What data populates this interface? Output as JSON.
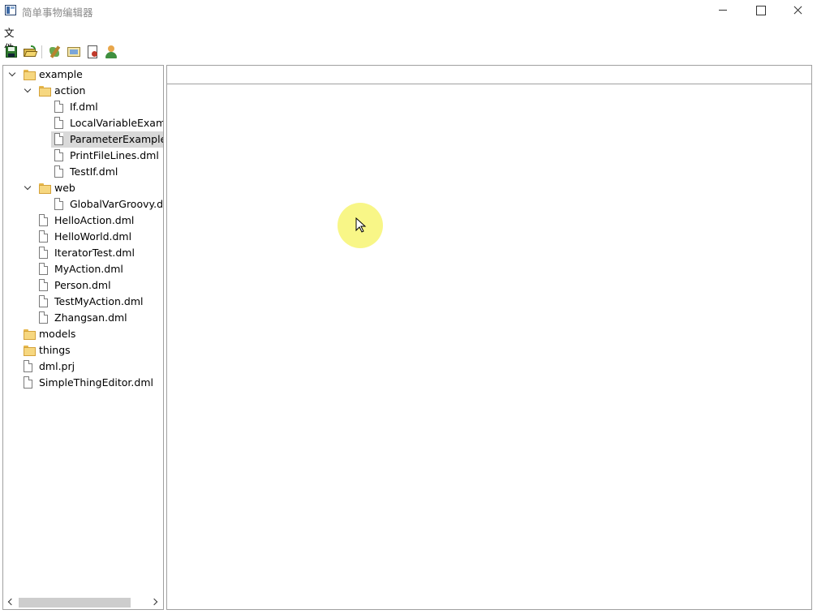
{
  "window": {
    "title": "简单事物编辑器",
    "controls": {
      "minimize": "minimize",
      "maximize": "maximize",
      "close": "close"
    }
  },
  "menu": {
    "items": [
      "文件"
    ]
  },
  "toolbar": {
    "icons": [
      "save-icon",
      "open-folder-icon",
      "thing-tool-icon",
      "image-icon",
      "document-red-icon",
      "user-icon"
    ]
  },
  "tree": {
    "nodes": [
      {
        "label": "example",
        "type": "folder",
        "depth": 0,
        "expanded": true
      },
      {
        "label": "action",
        "type": "folder",
        "depth": 1,
        "expanded": true
      },
      {
        "label": "If.dml",
        "type": "file",
        "depth": 2
      },
      {
        "label": "LocalVariableExample.dml",
        "type": "file",
        "depth": 2
      },
      {
        "label": "ParameterExample.dml",
        "type": "file",
        "depth": 2,
        "selected": true
      },
      {
        "label": "PrintFileLines.dml",
        "type": "file",
        "depth": 2
      },
      {
        "label": "TestIf.dml",
        "type": "file",
        "depth": 2
      },
      {
        "label": "web",
        "type": "folder",
        "depth": 1,
        "expanded": true
      },
      {
        "label": "GlobalVarGroovy.dml",
        "type": "file",
        "depth": 2
      },
      {
        "label": "HelloAction.dml",
        "type": "file",
        "depth": 1
      },
      {
        "label": "HelloWorld.dml",
        "type": "file",
        "depth": 1
      },
      {
        "label": "IteratorTest.dml",
        "type": "file",
        "depth": 1
      },
      {
        "label": "MyAction.dml",
        "type": "file",
        "depth": 1
      },
      {
        "label": "Person.dml",
        "type": "file",
        "depth": 1
      },
      {
        "label": "TestMyAction.dml",
        "type": "file",
        "depth": 1
      },
      {
        "label": "Zhangsan.dml",
        "type": "file",
        "depth": 1
      },
      {
        "label": "models",
        "type": "folder",
        "depth": 0,
        "expanded": false
      },
      {
        "label": "things",
        "type": "folder",
        "depth": 0,
        "expanded": false
      },
      {
        "label": "dml.prj",
        "type": "file",
        "depth": 0
      },
      {
        "label": "SimpleThingEditor.dml",
        "type": "file",
        "depth": 0
      }
    ]
  },
  "editor": {
    "header_text": ""
  },
  "colors": {
    "selection": "#d9d9d9",
    "border": "#a0a0a0",
    "cursor_highlight": "#f7f57a"
  }
}
